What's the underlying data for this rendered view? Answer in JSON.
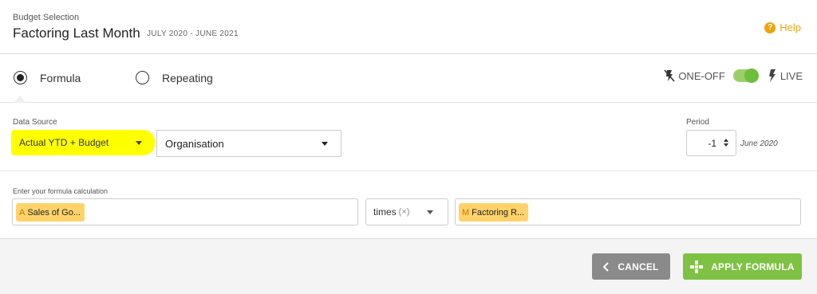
{
  "header": {
    "section_label": "Budget Selection",
    "title": "Factoring Last Month",
    "date_range": "JULY 2020 - JUNE 2021",
    "help_label": "Help"
  },
  "mode": {
    "options": [
      {
        "label": "Formula",
        "selected": true
      },
      {
        "label": "Repeating",
        "selected": false
      }
    ],
    "one_off_label": "ONE-OFF",
    "live_label": "LIVE",
    "live_enabled": true
  },
  "data_source": {
    "label": "Data Source",
    "source_value": "Actual YTD + Budget",
    "scope_value": "Organisation"
  },
  "period": {
    "label": "Period",
    "value": "-1",
    "resolved_month": "June 2020"
  },
  "formula": {
    "label": "Enter your formula calculation",
    "left_operand": {
      "tag": "A",
      "text": "Sales of Go..."
    },
    "operator": {
      "label": "times",
      "symbol": "(×)"
    },
    "right_operand": {
      "tag": "M",
      "text": "Factoring R..."
    }
  },
  "actions": {
    "cancel_label": "CANCEL",
    "apply_label": "APPLY FORMULA"
  },
  "colors": {
    "accent_green": "#7dc242",
    "help_orange": "#f0a30a",
    "highlight_yellow": "#ffff00",
    "chip_yellow": "#ffd36a",
    "cancel_grey": "#8a8a8a"
  },
  "icons": {
    "help": "question-circle-icon",
    "one_off": "flash-off-icon",
    "live": "flash-icon",
    "cancel": "chevron-left-icon",
    "apply": "puzzle-apply-icon"
  }
}
